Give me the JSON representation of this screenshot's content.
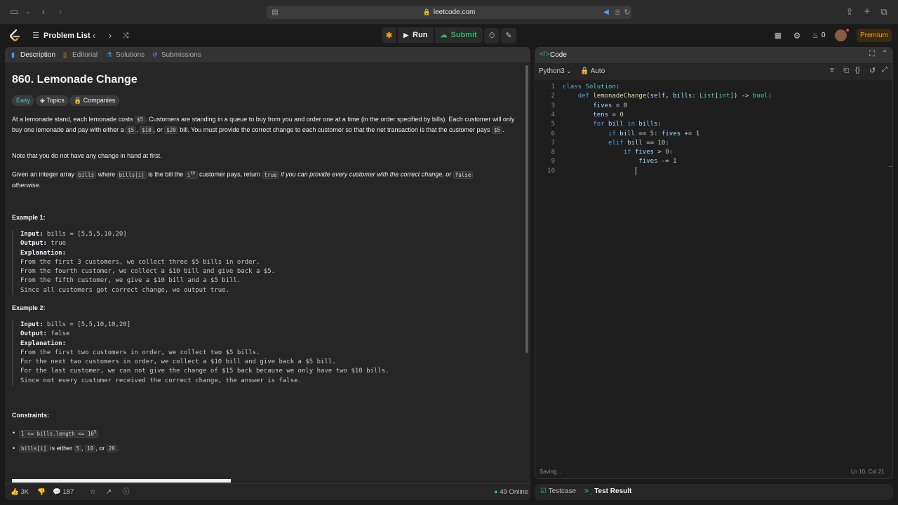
{
  "browser": {
    "url": "leetcode.com"
  },
  "nav": {
    "problem_list": "Problem List",
    "run": "Run",
    "submit": "Submit",
    "streak": "0",
    "premium": "Premium"
  },
  "left": {
    "tabs": [
      "Description",
      "Editorial",
      "Solutions",
      "Submissions"
    ],
    "title": "860. Lemonade Change",
    "tags": [
      "Easy",
      "Topics",
      "Companies"
    ],
    "p1_a": "At a lemonade stand, each lemonade costs ",
    "p1_price": "$5",
    "p1_b": ". Customers are standing in a queue to buy from you and order one at a time (in the order specified by bills). Each customer will only buy one lemonade and pay with either a ",
    "p1_c5": "$5",
    "p1_c10": "$10",
    "p1_or": ", or ",
    "p1_c20": "$20",
    "p1_d": " bill. You must provide the correct change to each customer so that the net transaction is that the customer pays ",
    "p1_end": "$5",
    "p2": "Note that you do not have any change in hand at first.",
    "p3_a": "Given an integer array ",
    "p3_bills": "bills",
    "p3_b": " where ",
    "p3_billsi": "bills[i]",
    "p3_c": " is the bill the ",
    "p3_ith": "i",
    "p3_th": "th",
    "p3_d": " customer pays, return ",
    "p3_true": "true",
    "p3_e": " if you can provide every customer with the correct change, or ",
    "p3_false": "false",
    "p3_f": "otherwise",
    "ex1_title": "Example 1:",
    "ex1": {
      "input_label": "Input:",
      "input": " bills = [5,5,5,10,20]",
      "output_label": "Output:",
      "output": " true",
      "expl_label": "Explanation:",
      "lines": [
        "From the first 3 customers, we collect three $5 bills in order.",
        "From the fourth customer, we collect a $10 bill and give back a $5.",
        "From the fifth customer, we give a $10 bill and a $5 bill.",
        "Since all customers got correct change, we output true."
      ]
    },
    "ex2_title": "Example 2:",
    "ex2": {
      "input_label": "Input:",
      "input": " bills = [5,5,10,10,20]",
      "output_label": "Output:",
      "output": " false",
      "expl_label": "Explanation:",
      "lines": [
        "From the first two customers in order, we collect two $5 bills.",
        "For the next two customers in order, we collect a $10 bill and give back a $5 bill.",
        "For the last customer, we can not give the change of $15 back because we only have two $10 bills.",
        "Since not every customer received the correct change, the answer is false."
      ]
    },
    "constraints_title": "Constraints:",
    "c1": "1 <= bills.length <= 10",
    "c1_sup": "5",
    "c2_code": "bills[i]",
    "c2_text": " is either ",
    "c2_v1": "5",
    "c2_comma": ", ",
    "c2_v2": "10",
    "c2_or": ", or ",
    "c2_v3": "20",
    "c2_end": ".",
    "bottom": {
      "likes": "3K",
      "comments": "187",
      "online": "49 Online"
    }
  },
  "right": {
    "header": "Code",
    "language": "Python3",
    "auto": "Auto",
    "status_left": "Saving...",
    "status_right": "Ln 10, Col 21",
    "tab_testcase": "Testcase",
    "tab_result": "Test Result"
  },
  "code_lines": [
    "1",
    "2",
    "3",
    "4",
    "5",
    "6",
    "7",
    "8",
    "9",
    "10"
  ],
  "colors": {
    "accent_orange": "#ffa116",
    "easy": "#46c6c2",
    "submit_green": "#2cbb5d"
  }
}
